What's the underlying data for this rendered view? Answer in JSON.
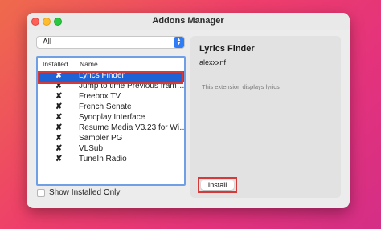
{
  "window": {
    "title": "Addons Manager"
  },
  "filter": {
    "selected": "All",
    "arrow_glyph": "▲▼"
  },
  "list": {
    "columns": [
      "Installed",
      "Name"
    ],
    "rows": [
      {
        "installed": "✘",
        "name": "Lyrics Finder",
        "selected": true
      },
      {
        "installed": "✘",
        "name": "Jump to time Previous fram…",
        "selected": false
      },
      {
        "installed": "✘",
        "name": "Freebox TV",
        "selected": false
      },
      {
        "installed": "✘",
        "name": "French Senate",
        "selected": false
      },
      {
        "installed": "✘",
        "name": "Syncplay Interface",
        "selected": false
      },
      {
        "installed": "✘",
        "name": "Resume Media V3.23 for Wi…",
        "selected": false
      },
      {
        "installed": "✘",
        "name": "Sampler PG",
        "selected": false
      },
      {
        "installed": "✘",
        "name": "VLSub",
        "selected": false
      },
      {
        "installed": "✘",
        "name": "TuneIn Radio",
        "selected": false
      }
    ]
  },
  "show_installed_only": {
    "label": "Show Installed Only",
    "checked": false
  },
  "detail": {
    "title": "Lyrics Finder",
    "author": "alexxxnf",
    "description": "This extension displays lyrics",
    "install_label": "Install"
  },
  "colors": {
    "selection": "#1d63d6",
    "accent": "#2f7cf6",
    "highlight_outline": "#d43a3a"
  }
}
